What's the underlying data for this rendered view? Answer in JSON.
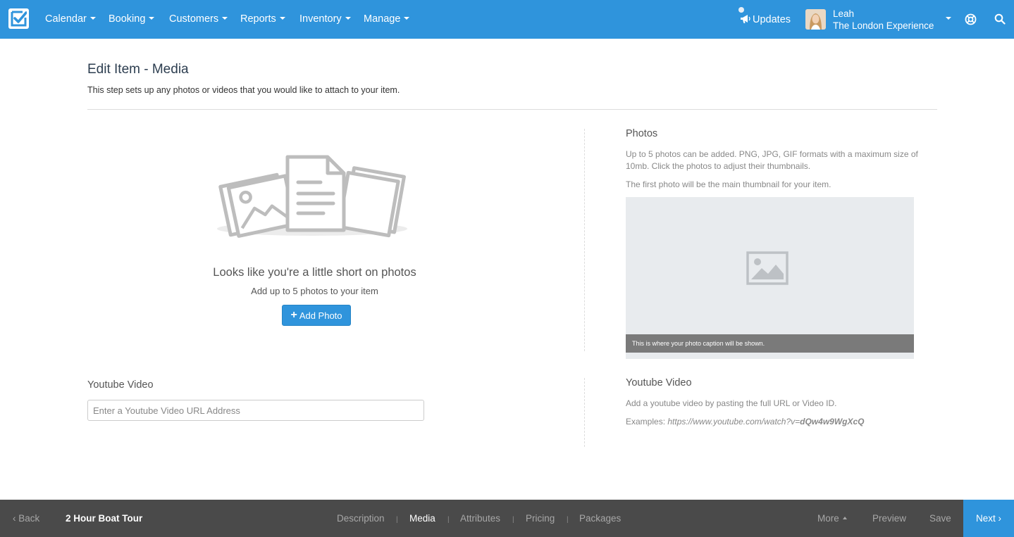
{
  "nav": {
    "items": [
      "Calendar",
      "Booking",
      "Customers",
      "Reports",
      "Inventory",
      "Manage"
    ],
    "updates": "Updates",
    "user_name": "Leah",
    "user_org": "The London Experience",
    "accent": "#2f94dc"
  },
  "header": {
    "title": "Edit Item - Media",
    "subtitle": "This step sets up any photos or videos that you would like to attach to your item."
  },
  "empty_state": {
    "title": "Looks like you're a little short on photos",
    "subtitle": "Add up to 5 photos to your item",
    "button": "Add Photo"
  },
  "photos_help": {
    "title": "Photos",
    "text1": "Up to 5 photos can be added. PNG, JPG, GIF formats with a maximum size of 10mb. Click the photos to adjust their thumbnails.",
    "text2": "The first photo will be the main thumbnail for your item.",
    "caption": "This is where your photo caption will be shown."
  },
  "youtube": {
    "label": "Youtube Video",
    "placeholder": "Enter a Youtube Video URL Address",
    "value": "",
    "help_title": "Youtube Video",
    "help_text": "Add a youtube video by pasting the full URL or Video ID.",
    "examples_label": "Examples:",
    "examples_url": "https://www.youtube.com/watch?v=",
    "examples_id": "dQw4w9WgXcQ"
  },
  "bottom": {
    "back": "Back",
    "item_title": "2 Hour Boat Tour",
    "steps": [
      "Description",
      "Media",
      "Attributes",
      "Pricing",
      "Packages"
    ],
    "active_step": "Media",
    "more": "More",
    "preview": "Preview",
    "save": "Save",
    "next": "Next"
  }
}
